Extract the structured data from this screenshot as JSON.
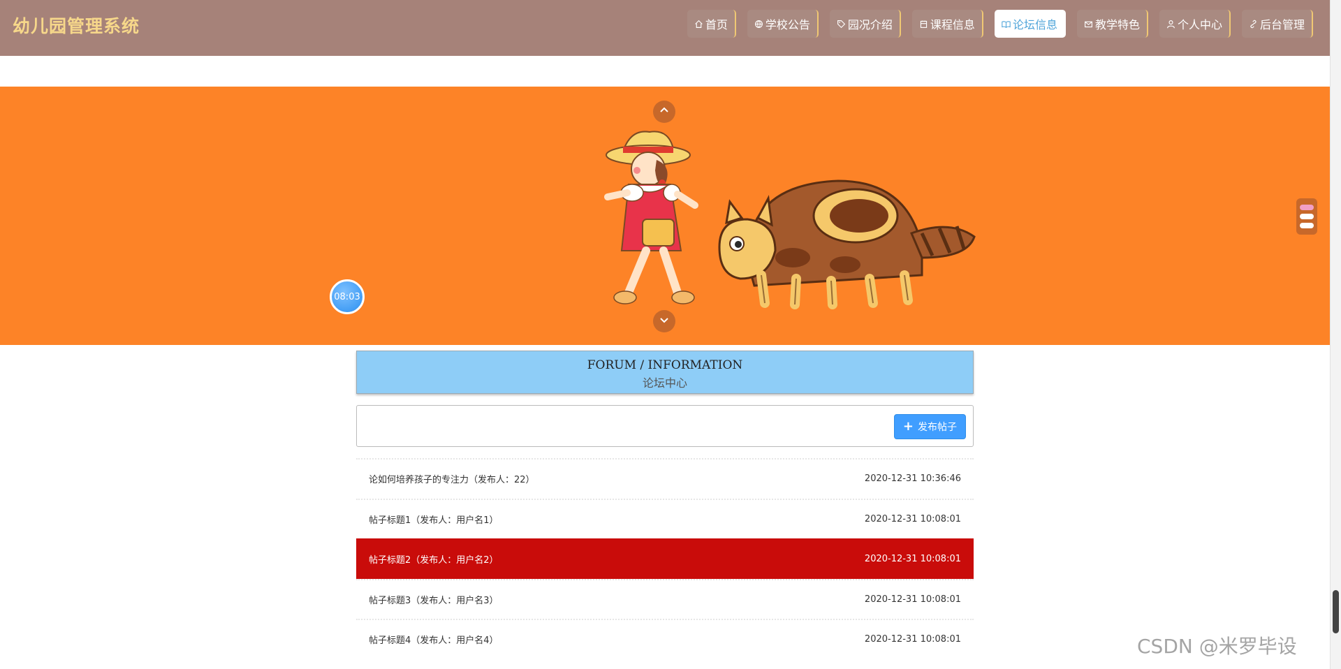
{
  "header": {
    "title": "幼儿园管理系统",
    "nav": [
      {
        "label": "首页",
        "icon": "home-icon"
      },
      {
        "label": "学校公告",
        "icon": "globe-icon"
      },
      {
        "label": "园况介绍",
        "icon": "tag-icon"
      },
      {
        "label": "课程信息",
        "icon": "calendar-icon"
      },
      {
        "label": "论坛信息",
        "icon": "book-icon",
        "active": true
      },
      {
        "label": "教学特色",
        "icon": "mail-icon"
      },
      {
        "label": "个人中心",
        "icon": "user-icon"
      },
      {
        "label": "后台管理",
        "icon": "link-icon"
      }
    ]
  },
  "banner": {
    "clock": "08:03",
    "indicator_count": 3,
    "active_indicator": 1
  },
  "forum": {
    "title_en": "FORUM / INFORMATION",
    "title_cn": "论坛中心",
    "publish_label": "发布帖子"
  },
  "posts": [
    {
      "title": "论如何培养孩子的专注力（发布人：22）",
      "time": "2020-12-31 10:36:46"
    },
    {
      "title": "帖子标题1（发布人：用户名1）",
      "time": "2020-12-31 10:08:01"
    },
    {
      "title": "帖子标题2（发布人：用户名2）",
      "time": "2020-12-31 10:08:01",
      "highlighted": true
    },
    {
      "title": "帖子标题3（发布人：用户名3）",
      "time": "2020-12-31 10:08:01"
    },
    {
      "title": "帖子标题4（发布人：用户名4）",
      "time": "2020-12-31 10:08:01"
    }
  ],
  "colors": {
    "header_bg": "#a68279",
    "title": "#f6d78a",
    "banner_bg": "#fd8327",
    "forum_head_bg": "#8ecdf7",
    "highlight_row": "#c90c0a",
    "primary_button": "#409eff"
  },
  "watermark": "CSDN @米罗毕设"
}
